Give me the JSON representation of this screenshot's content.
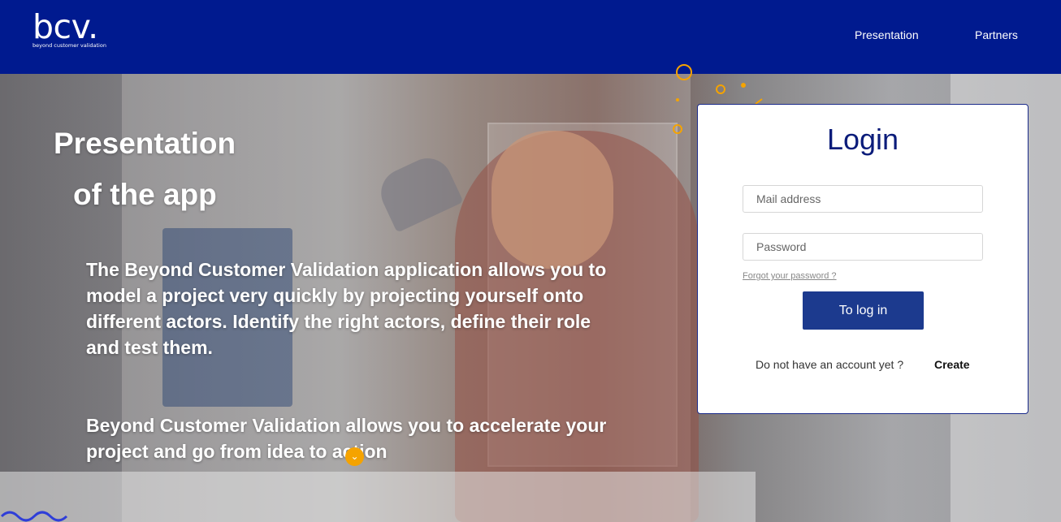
{
  "header": {
    "logo": "bcv.",
    "tagline": "beyond customer validation",
    "nav": [
      "Presentation",
      "Partners"
    ]
  },
  "hero": {
    "title_line1": "Presentation",
    "title_line2": "of the app",
    "paragraph1": "The Beyond Customer Validation application allows you to model a project very quickly by projecting yourself onto different actors. Identify the right actors, define their role and test them.",
    "paragraph2": "Beyond Customer Validation allows you to accelerate your project and go from idea to action",
    "scroll_icon": "chevron-down-icon"
  },
  "login": {
    "title": "Login",
    "mail_placeholder": "Mail address",
    "password_placeholder": "Password",
    "forgot_label": "Forgot your password ?",
    "submit_label": "To log in",
    "no_account_text": "Do not have an account yet ?",
    "create_label": "Create"
  },
  "colors": {
    "header_bg": "#001a8f",
    "button_bg": "#1c3a8e",
    "accent_orange": "#f5a300",
    "title_blue": "#0b1c7a"
  }
}
